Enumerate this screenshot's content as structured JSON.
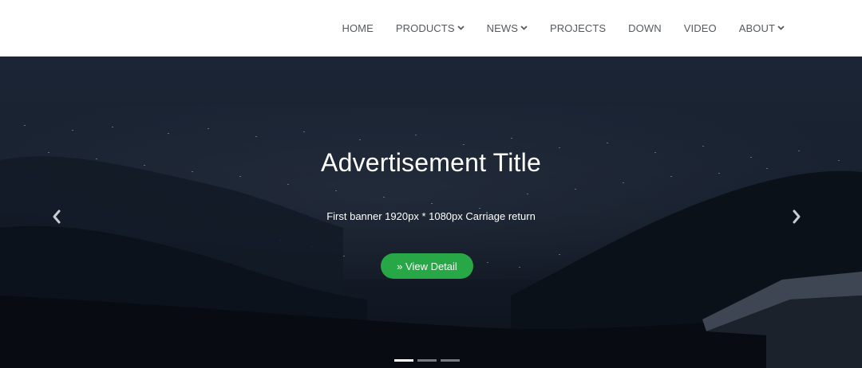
{
  "nav": {
    "items": [
      {
        "label": "HOME",
        "has_dropdown": false
      },
      {
        "label": "PRODUCTS",
        "has_dropdown": true
      },
      {
        "label": "NEWS",
        "has_dropdown": true
      },
      {
        "label": "PROJECTS",
        "has_dropdown": false
      },
      {
        "label": "DOWN",
        "has_dropdown": false
      },
      {
        "label": "VIDEO",
        "has_dropdown": false
      },
      {
        "label": "ABOUT",
        "has_dropdown": true
      }
    ]
  },
  "banner": {
    "title": "Advertisement Title",
    "subtitle": "First banner 1920px * 1080px Carriage return",
    "button_label": "» View Detail",
    "slides": 3,
    "active_slide": 1,
    "prev_icon": "chevron-left-icon",
    "next_icon": "chevron-right-icon"
  },
  "colors": {
    "accent": "#27a745",
    "nav_text": "#555a60",
    "banner_bg": "#0f1622"
  }
}
